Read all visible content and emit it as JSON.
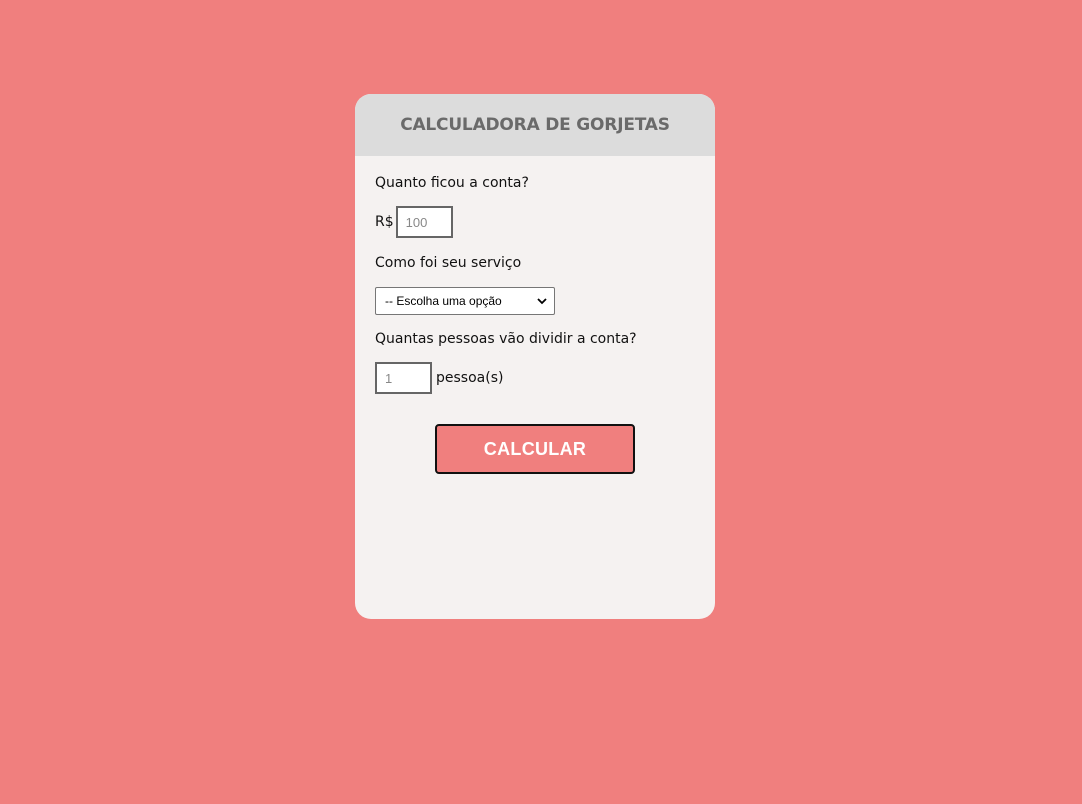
{
  "header": {
    "title": "CALCULADORA DE GORJETAS"
  },
  "bill": {
    "label": "Quanto ficou a conta?",
    "currency": "R$",
    "placeholder": "100"
  },
  "service": {
    "label": "Como foi seu serviço",
    "selected": "-- Escolha uma opção"
  },
  "people": {
    "label": "Quantas pessoas vão dividir a conta?",
    "placeholder": "1",
    "suffix": "pessoa(s)"
  },
  "actions": {
    "calculate_label": "CALCULAR"
  },
  "colors": {
    "background": "#f07f7e",
    "card": "#f5f2f1",
    "header": "#dcdcdc",
    "button": "#f07f7e"
  }
}
